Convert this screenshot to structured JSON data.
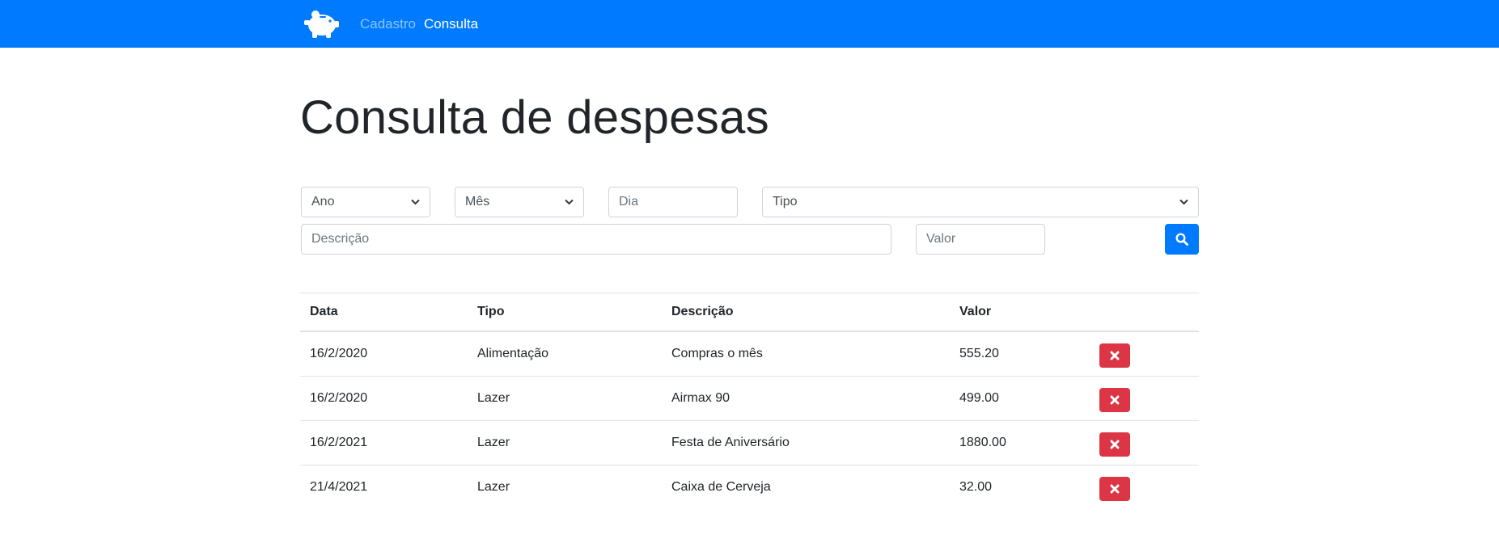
{
  "nav": {
    "logo_icon": "piggy-bank-icon",
    "links": [
      {
        "label": "Cadastro"
      },
      {
        "label": "Consulta"
      }
    ]
  },
  "page": {
    "title": "Consulta de despesas"
  },
  "filters": {
    "ano": {
      "value": "Ano"
    },
    "mes": {
      "value": "Mês"
    },
    "dia": {
      "placeholder": "Dia"
    },
    "tipo": {
      "value": "Tipo"
    },
    "descricao": {
      "placeholder": "Descrição"
    },
    "valor": {
      "placeholder": "Valor"
    },
    "search_icon": "search-icon"
  },
  "table": {
    "headers": [
      "Data",
      "Tipo",
      "Descrição",
      "Valor",
      ""
    ],
    "rows": [
      {
        "data": "16/2/2020",
        "tipo": "Alimentação",
        "descricao": "Compras o mês",
        "valor": "555.20"
      },
      {
        "data": "16/2/2020",
        "tipo": "Lazer",
        "descricao": "Airmax 90",
        "valor": "499.00"
      },
      {
        "data": "16/2/2021",
        "tipo": "Lazer",
        "descricao": "Festa de Aniversário",
        "valor": "1880.00"
      },
      {
        "data": "21/4/2021",
        "tipo": "Lazer",
        "descricao": "Caixa de Cerveja",
        "valor": "32.00"
      }
    ],
    "delete_icon": "close-icon"
  },
  "colors": {
    "primary": "#007bff",
    "danger": "#dc3545"
  }
}
